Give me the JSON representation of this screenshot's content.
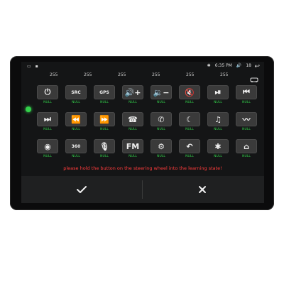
{
  "status": {
    "time": "6:35 PM",
    "battery": "18"
  },
  "columns": [
    "255",
    "255",
    "255",
    "255",
    "255",
    "255"
  ],
  "rows": [
    [
      {
        "icon": "power-icon",
        "glyph": "⏻",
        "label": "NULL"
      },
      {
        "icon": "src-icon",
        "glyph": "SRC",
        "label": "NULL"
      },
      {
        "icon": "gps-icon",
        "glyph": "GPS",
        "label": "NULL"
      },
      {
        "icon": "volume-up-icon",
        "glyph": "🔊+",
        "label": "NULL"
      },
      {
        "icon": "volume-down-icon",
        "glyph": "🔉−",
        "label": "NULL"
      },
      {
        "icon": "mute-icon",
        "glyph": "🔇",
        "label": "NULL"
      },
      {
        "icon": "play-pause-icon",
        "glyph": "⏯",
        "label": "NULL"
      },
      {
        "icon": "previous-icon",
        "glyph": "⏮",
        "label": "NULL"
      }
    ],
    [
      {
        "icon": "next-icon",
        "glyph": "⏭",
        "label": "NULL"
      },
      {
        "icon": "rewind-icon",
        "glyph": "⏪",
        "label": "NULL"
      },
      {
        "icon": "fast-forward-icon",
        "glyph": "⏩",
        "label": "NULL"
      },
      {
        "icon": "phone-icon",
        "glyph": "☎",
        "label": "NULL"
      },
      {
        "icon": "hangup-icon",
        "glyph": "✆",
        "label": "NULL"
      },
      {
        "icon": "night-icon",
        "glyph": "☾",
        "label": "NULL"
      },
      {
        "icon": "voice-icon",
        "glyph": "♫",
        "label": "NULL"
      },
      {
        "icon": "wave-icon",
        "glyph": "〰",
        "label": "NULL"
      }
    ],
    [
      {
        "icon": "radio-icon",
        "glyph": "◉",
        "label": "NULL"
      },
      {
        "icon": "360-icon",
        "glyph": "360",
        "label": "NULL"
      },
      {
        "icon": "mic-icon",
        "glyph": "🎙",
        "label": "NULL"
      },
      {
        "icon": "fm-icon",
        "glyph": "FM",
        "label": "NULL"
      },
      {
        "icon": "settings-icon",
        "glyph": "⚙",
        "label": "NULL"
      },
      {
        "icon": "back-icon",
        "glyph": "↶",
        "label": "NULL"
      },
      {
        "icon": "bluetooth-icon",
        "glyph": "✱",
        "label": "NULL"
      },
      {
        "icon": "home-icon",
        "glyph": "⌂",
        "label": "NULL"
      }
    ]
  ],
  "instruction": "please hold the button on the steering wheel into the learning state!",
  "colors": {
    "null": "#33d14b",
    "instruction": "#ff3b3b"
  }
}
